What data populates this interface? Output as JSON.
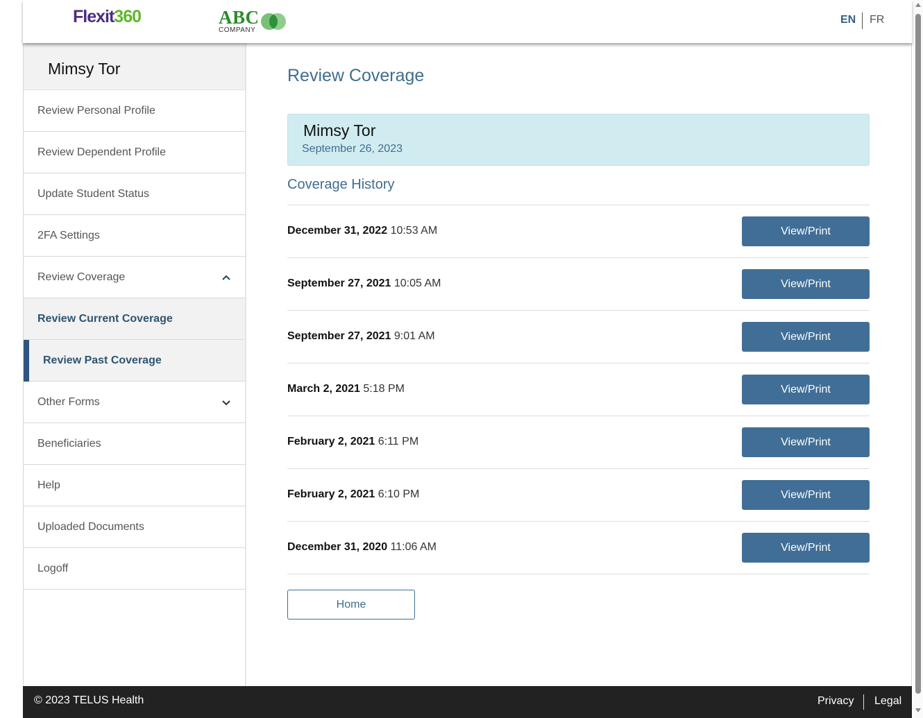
{
  "header": {
    "logo_flex": "Flexit",
    "logo_num": "360",
    "company_abc": "ABC",
    "company_name": "COMPANY",
    "lang_en": "EN",
    "lang_fr": "FR"
  },
  "sidebar": {
    "user_name": "Mimsy Tor",
    "items": [
      {
        "label": "Review Personal Profile"
      },
      {
        "label": "Review Dependent Profile"
      },
      {
        "label": "Update Student Status"
      },
      {
        "label": "2FA Settings"
      },
      {
        "label": "Review Coverage",
        "icon": "chevron-up-icon"
      },
      {
        "label": "Review Current Coverage"
      },
      {
        "label": "Review Past Coverage",
        "active": true
      },
      {
        "label": "Other Forms",
        "icon": "chevron-down-icon"
      },
      {
        "label": "Beneficiaries"
      },
      {
        "label": "Help"
      },
      {
        "label": "Uploaded Documents"
      },
      {
        "label": "Logoff"
      }
    ]
  },
  "main": {
    "title": "Review Coverage",
    "member_name": "Mimsy Tor",
    "member_date": "September 26, 2023",
    "history_title": "Coverage History",
    "button_label": "View/Print",
    "history": [
      {
        "date": "December 31, 2022",
        "time": "10:53 AM"
      },
      {
        "date": "September 27, 2021",
        "time": "10:05 AM"
      },
      {
        "date": "September 27, 2021",
        "time": "9:01 AM"
      },
      {
        "date": "March 2, 2021",
        "time": "5:18 PM"
      },
      {
        "date": "February 2, 2021",
        "time": "6:11 PM"
      },
      {
        "date": "February 2, 2021",
        "time": "6:10 PM"
      },
      {
        "date": "December 31, 2020",
        "time": "11:06 AM"
      }
    ],
    "home_label": "Home"
  },
  "footer": {
    "copyright": "© 2023 TELUS Health",
    "privacy": "Privacy",
    "legal": "Legal"
  },
  "colors": {
    "accent": "#416e96",
    "heading": "#3f6e8e",
    "card_bg": "#d1ecf1",
    "footer_bg": "#222222",
    "brand_purple": "#4b2d83",
    "brand_green": "#5fb92b"
  }
}
